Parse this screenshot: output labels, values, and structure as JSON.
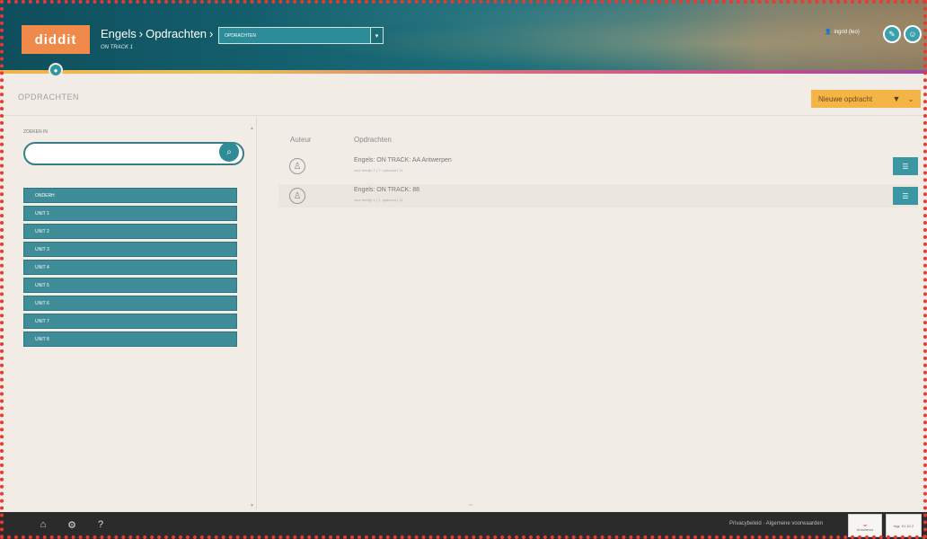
{
  "header": {
    "logo": "diddit",
    "breadcrumb": [
      "Engels",
      "Opdrachten"
    ],
    "subtitle": "ON TRACK 1",
    "selector_value": "OPDRACHTEN",
    "user": "ingrid (leo)"
  },
  "page": {
    "title": "OPDRACHTEN",
    "new_button": "Nieuwe opdracht"
  },
  "sidebar": {
    "search_label": "ZOEKEN IN",
    "search_placeholder": "",
    "units": [
      "ONDERH",
      "UNIT 1",
      "UNIT 2",
      "UNIT 3",
      "UNIT 4",
      "UNIT 5",
      "UNIT 6",
      "UNIT 7",
      "UNIT 8"
    ]
  },
  "main": {
    "columns": {
      "author": "Auteur",
      "assignments": "Opdrachten"
    },
    "rows": [
      {
        "title": "Engels: ON TRACK: AA Antwerpen",
        "meta": "voor leerlijn 1 | 7: opdracht | 11"
      },
      {
        "title": "Engels: ON TRACK: 88",
        "meta": "voor leerlijn 1 | 7: opdracht | 11"
      }
    ]
  },
  "footer": {
    "links": "Privacybeleid · Algemene voorwaarden",
    "box1": "Annuleren",
    "box2": "Ingr. 01 10 2"
  },
  "colors": {
    "teal": "#3e8d98",
    "accent_orange": "#f5b446",
    "logo_orange": "#f08a4b"
  }
}
